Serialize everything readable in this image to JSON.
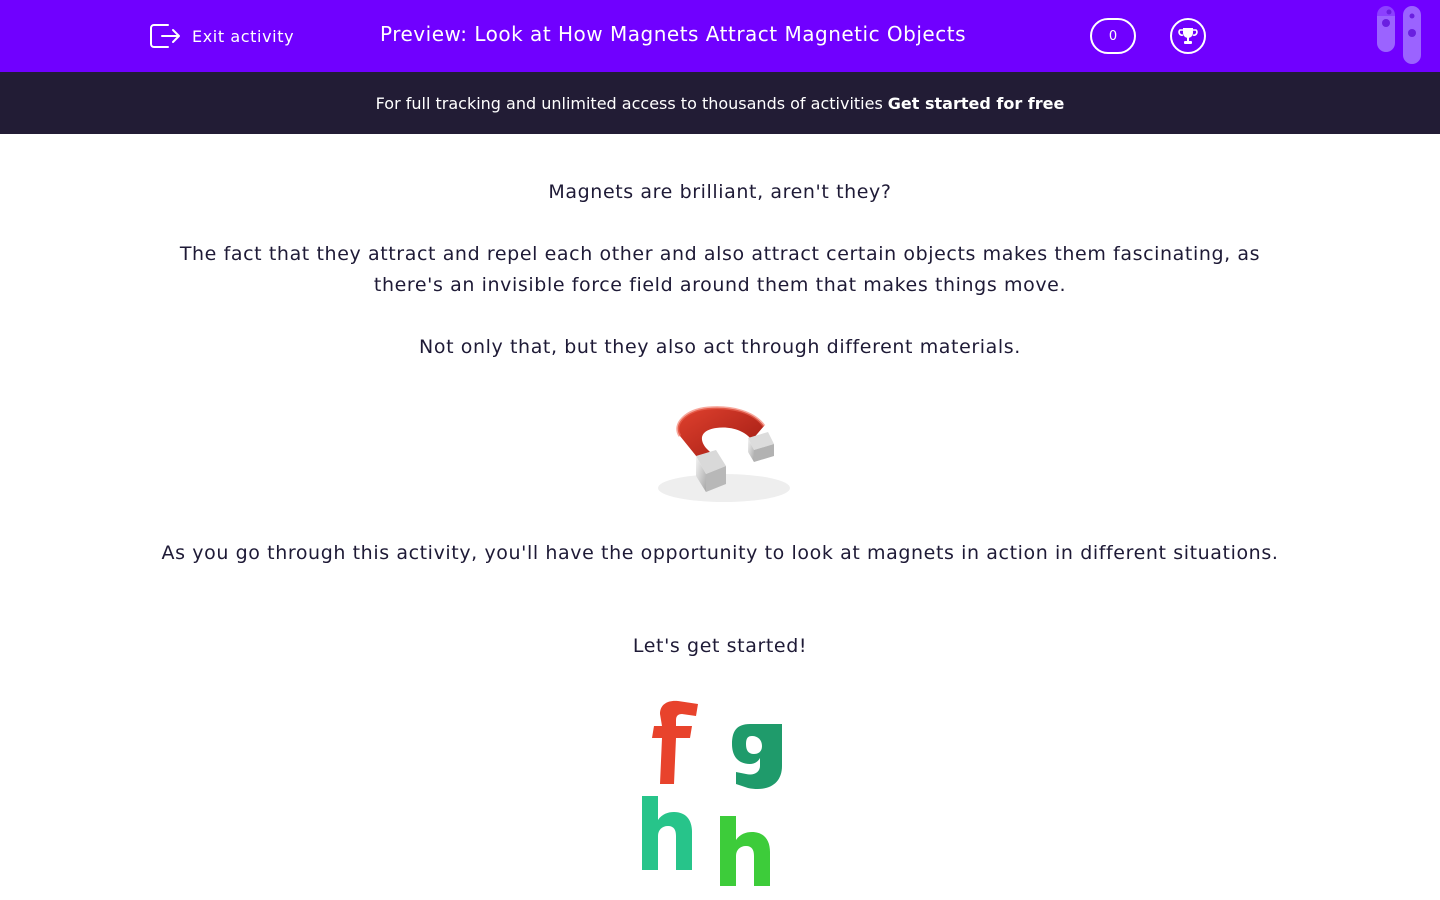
{
  "header": {
    "exit_label": "Exit activity",
    "title": "Preview: Look at How Magnets Attract Magnetic Objects",
    "score": "0",
    "brand_color": "#7000ff"
  },
  "banner": {
    "text": "For full tracking and unlimited access to thousands of activities",
    "cta": "Get started for free"
  },
  "content": {
    "paragraphs": [
      "Magnets are brilliant, aren't they?",
      "The fact that they attract and repel each other and also attract certain objects makes them fascinating, as there's an invisible force field around them that makes things move.",
      "Not only that, but they also act through different materials.",
      "As you go through this activity, you'll have the opportunity to look at magnets in action in different situations.",
      "Let's get started!"
    ]
  },
  "icons": {
    "exit": "exit-icon",
    "trophy": "trophy-icon",
    "logo": "test-tubes-logo"
  }
}
